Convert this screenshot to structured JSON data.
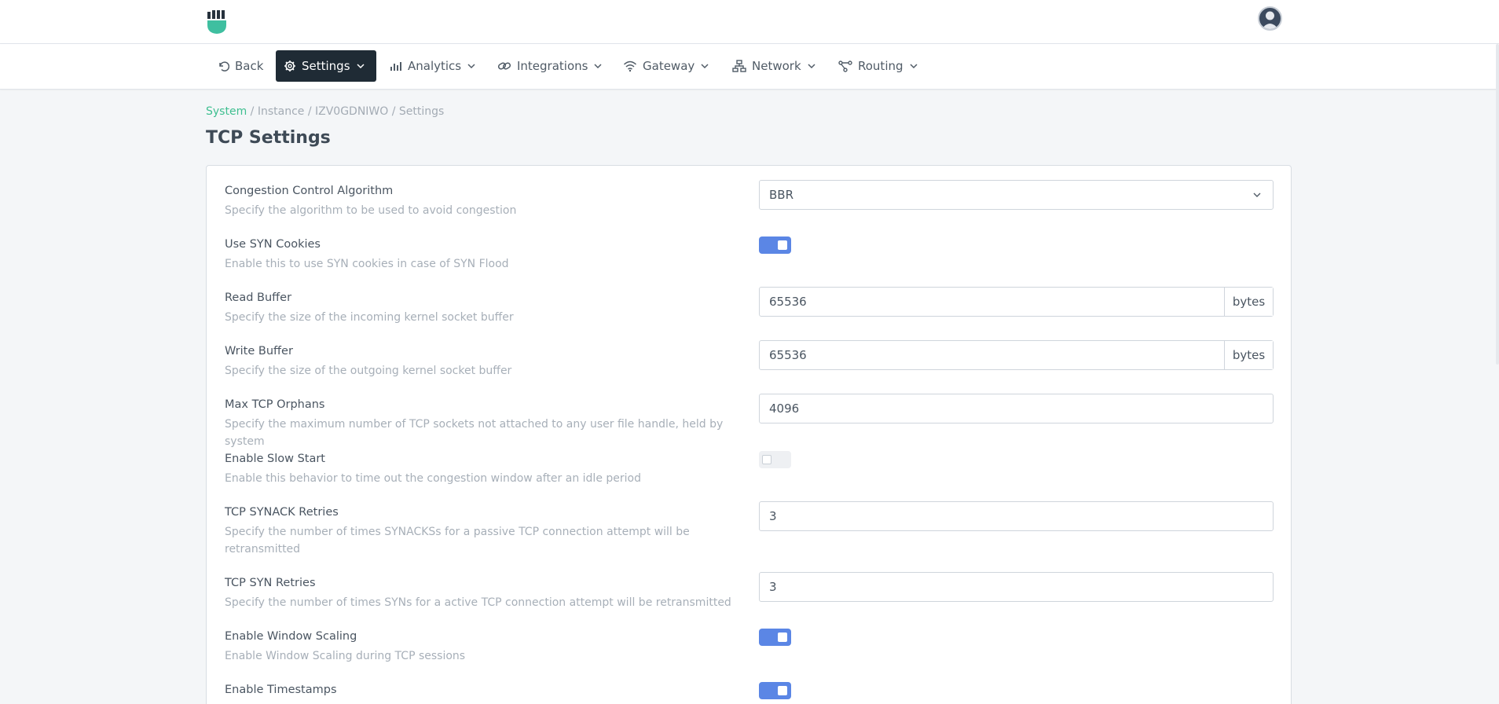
{
  "nav": {
    "items": [
      {
        "label": "Back",
        "icon": "undo-icon",
        "active": false
      },
      {
        "label": "Settings",
        "icon": "gear-icon",
        "active": true
      },
      {
        "label": "Analytics",
        "icon": "bar-chart-icon",
        "active": false
      },
      {
        "label": "Integrations",
        "icon": "link-icon",
        "active": false
      },
      {
        "label": "Gateway",
        "icon": "wifi-icon",
        "active": false
      },
      {
        "label": "Network",
        "icon": "network-icon",
        "active": false
      },
      {
        "label": "Routing",
        "icon": "routing-icon",
        "active": false
      }
    ]
  },
  "breadcrumb": {
    "system": "System",
    "rest": " / Instance / IZV0GDNIWO / Settings"
  },
  "page": {
    "title": "TCP Settings"
  },
  "settings": {
    "congestion": {
      "label": "Congestion Control Algorithm",
      "desc": "Specify the algorithm to be used to avoid congestion",
      "value": "BBR"
    },
    "syn_cookies": {
      "label": "Use SYN Cookies",
      "desc": "Enable this to use SYN cookies in case of SYN Flood",
      "enabled": true
    },
    "read_buffer": {
      "label": "Read Buffer",
      "desc": "Specify the size of the incoming kernel socket buffer",
      "value": "65536",
      "unit": "bytes"
    },
    "write_buffer": {
      "label": "Write Buffer",
      "desc": "Specify the size of the outgoing kernel socket buffer",
      "value": "65536",
      "unit": "bytes"
    },
    "max_orphans": {
      "label": "Max TCP Orphans",
      "desc": "Specify the maximum number of TCP sockets not attached to any user file handle, held by system",
      "value": "4096"
    },
    "slow_start": {
      "label": "Enable Slow Start",
      "desc": "Enable this behavior to time out the congestion window after an idle period",
      "enabled": false
    },
    "synack_retries": {
      "label": "TCP SYNACK Retries",
      "desc": "Specify the number of times SYNACKSs for a passive TCP connection attempt will be retransmitted",
      "value": "3"
    },
    "syn_retries": {
      "label": "TCP SYN Retries",
      "desc": "Specify the number of times SYNs for a active TCP connection attempt will be retransmitted",
      "value": "3"
    },
    "window_scaling": {
      "label": "Enable Window Scaling",
      "desc": "Enable Window Scaling during TCP sessions",
      "enabled": true
    },
    "timestamps": {
      "label": "Enable Timestamps",
      "desc": "",
      "enabled": true
    }
  },
  "colors": {
    "accent": "#3fbf90",
    "nav_active": "#1f2b35",
    "toggle_on": "#5b86e5"
  }
}
